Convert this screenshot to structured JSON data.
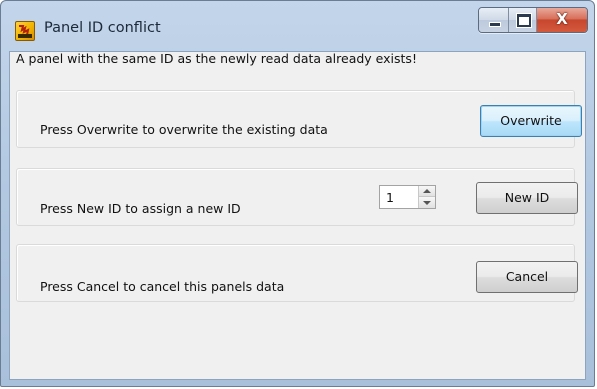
{
  "window": {
    "title": "Panel ID conflict",
    "icon": "fel-app-icon",
    "buttons": {
      "minimize_icon": "minimize-icon",
      "maximize_icon": "maximize-icon",
      "close_glyph": "X"
    }
  },
  "message": "A panel with the same ID as the newly read data already exists!",
  "overwrite_group": {
    "label": "Press Overwrite to overwrite the existing data",
    "button_label": "Overwrite"
  },
  "newid_group": {
    "label": "Press New ID to assign a new ID",
    "spinner_value": "1",
    "button_label": "New ID"
  },
  "cancel_group": {
    "label": "Press Cancel to cancel this panels data",
    "button_label": "Cancel"
  },
  "colors": {
    "titlebar": "#b3c9e2",
    "close_button": "#c7462e",
    "default_button_border": "#3c7fb1",
    "client_background": "#f0f0f0"
  }
}
